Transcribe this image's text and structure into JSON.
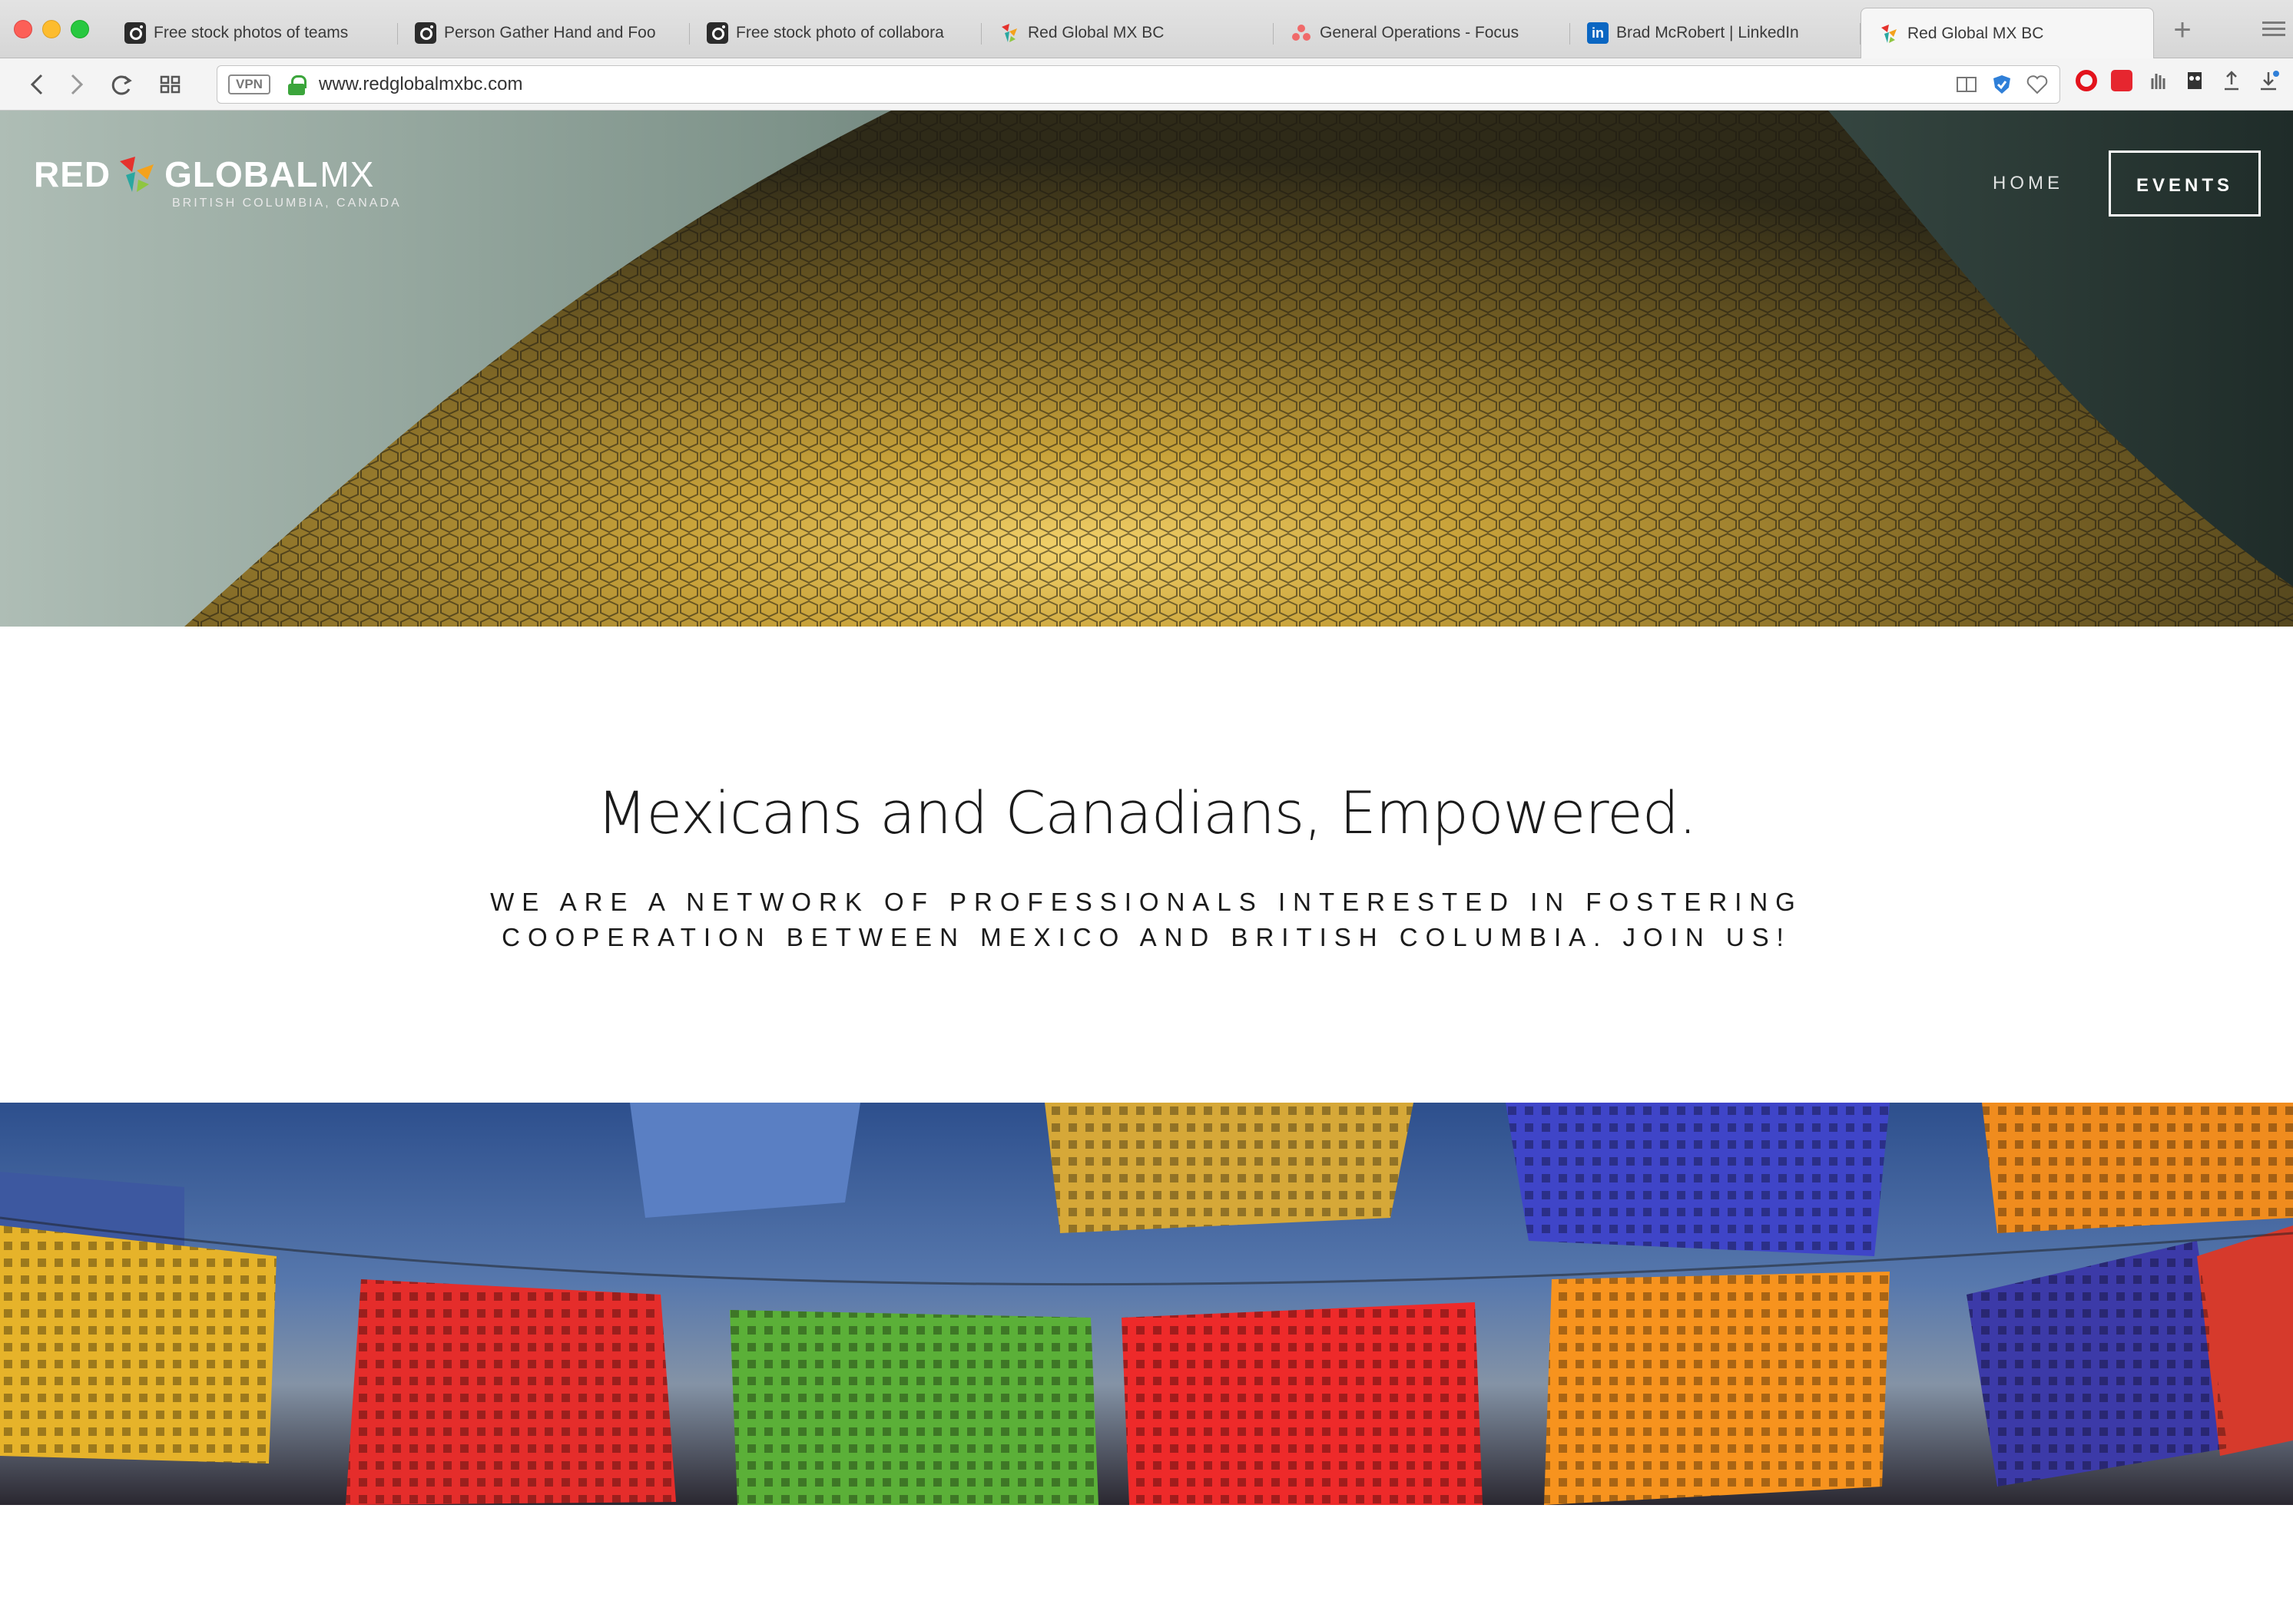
{
  "browser": {
    "tabs": [
      {
        "label": "Free stock photos of teams",
        "favicon": "camera-icon",
        "active": false
      },
      {
        "label": "Person Gather Hand and Foo",
        "favicon": "camera-icon",
        "active": false
      },
      {
        "label": "Free stock photo of collabora",
        "favicon": "camera-icon",
        "active": false
      },
      {
        "label": "Red Global MX BC",
        "favicon": "redglobal-icon",
        "active": false
      },
      {
        "label": "General Operations - Focus",
        "favicon": "asana-icon",
        "active": false
      },
      {
        "label": "Brad McRobert | LinkedIn",
        "favicon": "linkedin-icon",
        "active": false
      },
      {
        "label": "Red Global MX BC",
        "favicon": "redglobal-icon",
        "active": true
      }
    ],
    "address": {
      "vpn_label": "VPN",
      "url": "www.redglobalmxbc.com"
    },
    "accent": "#3ba53b"
  },
  "site": {
    "logo": {
      "red": "RED",
      "global": "GLOBAL",
      "mx": "MX",
      "subtitle": "BRITISH COLUMBIA, CANADA"
    },
    "nav": {
      "home": "HOME",
      "events": "EVENTS"
    },
    "headline": "Mexicans and Canadians, Empowered.",
    "tagline": "WE ARE A NETWORK OF PROFESSIONALS INTERESTED IN FOSTERING COOPERATION BETWEEN MEXICO AND BRITISH COLUMBIA. JOIN US!",
    "colors": {
      "text": "#1b1b1b",
      "hero_gold": "#c9a33a",
      "hero_teal": "#2a3b37"
    }
  }
}
